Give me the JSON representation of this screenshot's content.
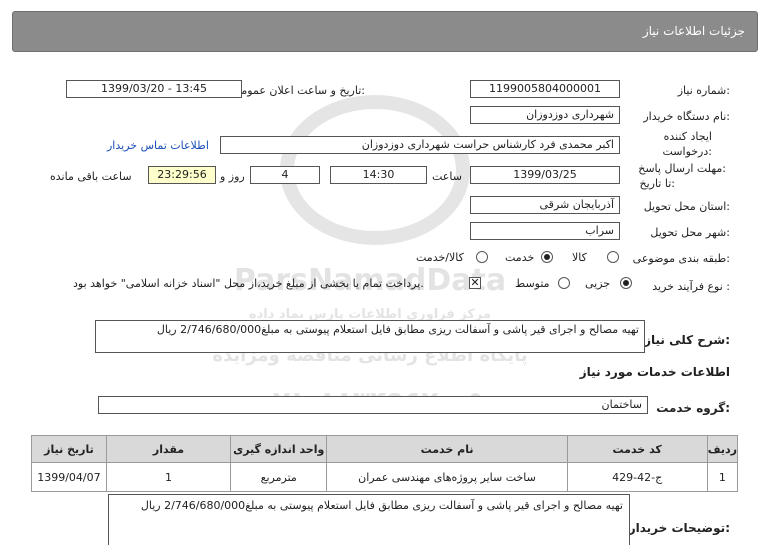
{
  "header": {
    "title": "جزئیات اطلاعات نیاز"
  },
  "need_number": {
    "label": "شماره نیاز:",
    "value": "1199005804000001"
  },
  "announce_datetime": {
    "label": "تاریخ و ساعت اعلان عمومی:",
    "value": "1399/03/20 - 13:45"
  },
  "buyer_org": {
    "label": "نام دستگاه خریدار:",
    "value": "شهرداری دوزدوزان"
  },
  "requester": {
    "label_line1": "ایجاد کننده",
    "label_line2": "درخواست:",
    "value": "اکبر محمدی فرد کارشناس حراست  شهرداری دوزدوزان",
    "contact_link": "اطلاعات تماس خریدار"
  },
  "deadline": {
    "label_line1": "مهلت ارسال پاسخ:",
    "label_line2": "تا تاریخ:",
    "date": "1399/03/25",
    "time_label": "ساعت",
    "time": "14:30",
    "days": "4",
    "days_label": "روز و",
    "remaining": "23:29:56",
    "remaining_label": "ساعت باقی مانده"
  },
  "delivery_province": {
    "label": "استان محل تحویل:",
    "value": "آذربایجان شرقی"
  },
  "delivery_city": {
    "label": "شهر محل تحویل:",
    "value": "سراب"
  },
  "category": {
    "label": "طبقه بندی موضوعی:",
    "options": [
      "کالا",
      "خدمت",
      "کالا/خدمت"
    ],
    "selected": "خدمت"
  },
  "purchase_process": {
    "label": "نوع فرآیند خرید :",
    "options": [
      "جزیی",
      "متوسط"
    ],
    "selected": "جزیی",
    "payment_note": "پرداخت تمام یا بخشی از مبلغ خرید،از محل \"اسناد خزانه اسلامی\" خواهد بود.",
    "payment_checked": true
  },
  "description": {
    "label": "شرح کلی نیاز:",
    "value": "تهیه مصالح و اجرای قیر پاشی و آسفالت ریزی مطابق فایل استعلام پیوستی به مبلغ2/746/680/000 ریال"
  },
  "services_section": {
    "title": "اطلاعات خدمات مورد نیاز"
  },
  "service_group": {
    "label": "گروه خدمت:",
    "value": "ساختمان"
  },
  "services_table": {
    "headers": [
      "ردیف",
      "کد خدمت",
      "نام خدمت",
      "واحد اندازه گیری",
      "مقدار",
      "تاریخ نیاز"
    ],
    "rows": [
      [
        "1",
        "ج-42-429",
        "ساخت سایر پروژه‌های مهندسی عمران",
        "مترمربع",
        "1",
        "1399/04/07"
      ]
    ]
  },
  "buyer_notes": {
    "label": "توضیحات خریدار:",
    "value": "تهیه مصالح و اجرای قیر پاشی و آسفالت ریزی مطابق فایل استعلام پیوستی به مبلغ2/746/680/000 ریال"
  },
  "watermark": {
    "brand": "ParsNamadData",
    "sub": "مرکز فراوری اطلاعات پارس نماد داده",
    "line": "پایگاه اطلاع رسانی مناقصه ومزایده",
    "phone": "۰۲۱-۸۸۳۴۹۶۷۰-۵"
  }
}
